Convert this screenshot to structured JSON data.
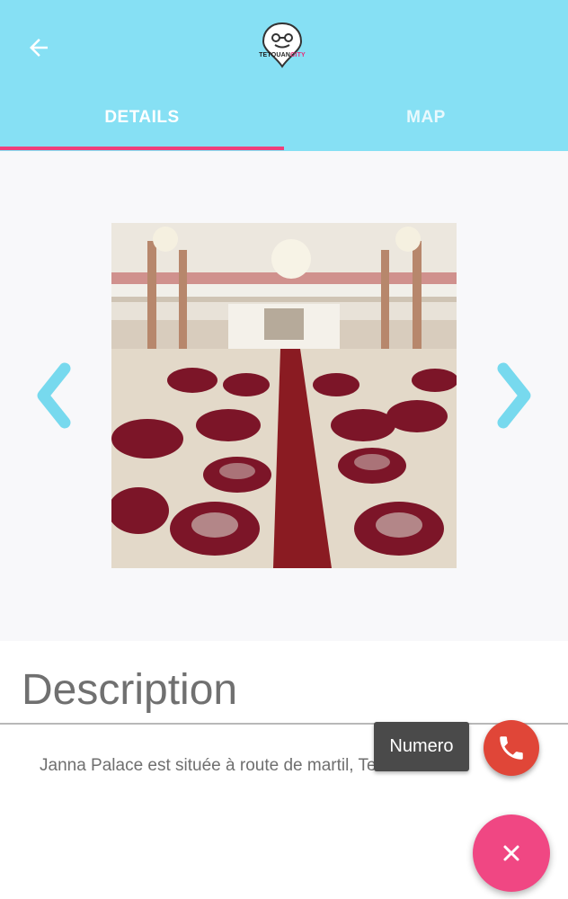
{
  "appbar": {
    "logo": {
      "brand": "TETOUAN",
      "brand_accent": "CITY"
    },
    "background_color": "#86e0f4"
  },
  "tabs": [
    {
      "label": "DETAILS",
      "active": true
    },
    {
      "label": "MAP",
      "active": false
    }
  ],
  "tab_indicator_color": "#ef3f7b",
  "gallery": {
    "prev_icon": "chevron-left-icon",
    "next_icon": "chevron-right-icon"
  },
  "description": {
    "title": "Description",
    "text": "Janna Palace est située à route de martil, Tetouan"
  },
  "fab": {
    "call_tooltip": "Numero",
    "call_icon": "phone-icon",
    "call_color": "#e04638",
    "close_icon": "close-icon",
    "close_color": "#f04783"
  }
}
